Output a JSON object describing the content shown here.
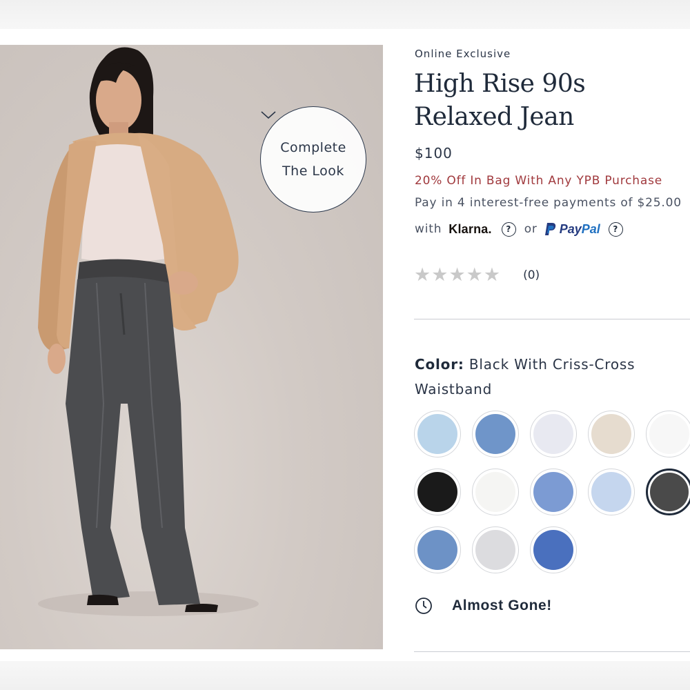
{
  "product_image": {
    "alt_overlay": {
      "line1": "Complete",
      "line2": "The Look"
    }
  },
  "product": {
    "eyebrow": "Online Exclusive",
    "title": "High Rise 90s Relaxed Jean",
    "price": "$100",
    "promo": "20% Off In Bag With Any YPB Purchase",
    "installments": "Pay in 4 interest-free payments of $25.00",
    "pay_with": "with",
    "klarna": "Klarna.",
    "or": "or",
    "paypal_pay": "Pay",
    "paypal_pal": "Pal",
    "help_glyph": "?",
    "rating_count": "(0)",
    "rating_value": 0,
    "rating_max": 5,
    "color_label": "Color:",
    "color_value": "Black With Criss-Cross Waistband",
    "stock_status": "Almost Gone!"
  },
  "swatches": [
    {
      "name": "light-wash",
      "color": "#b9d4ea",
      "selected": false
    },
    {
      "name": "medium-wash",
      "color": "#6f95c9",
      "selected": false
    },
    {
      "name": "ice-white",
      "color": "#e8e9f1",
      "selected": false
    },
    {
      "name": "ecru",
      "color": "#e6dccf",
      "selected": false
    },
    {
      "name": "white",
      "color": "#f7f7f7",
      "selected": false
    },
    {
      "name": "black",
      "color": "#1a1a1a",
      "selected": false
    },
    {
      "name": "off-white",
      "color": "#f5f5f3",
      "selected": false
    },
    {
      "name": "destroyed-medium",
      "color": "#7c9bd3",
      "selected": false
    },
    {
      "name": "light-ripped",
      "color": "#c5d6ee",
      "selected": false
    },
    {
      "name": "washed-black",
      "color": "#4a4a4a",
      "selected": true
    },
    {
      "name": "mid-blue",
      "color": "#6d92c6",
      "selected": false
    },
    {
      "name": "light-grey",
      "color": "#dcdcdf",
      "selected": false
    },
    {
      "name": "dark-wash",
      "color": "#4a70be",
      "selected": false
    }
  ],
  "colors": {
    "navy": "#1f2a3a",
    "promo_red": "#a0393d",
    "star_empty": "#c9c9c9",
    "paypal_dark": "#253b80",
    "paypal_light": "#1f70c1"
  }
}
